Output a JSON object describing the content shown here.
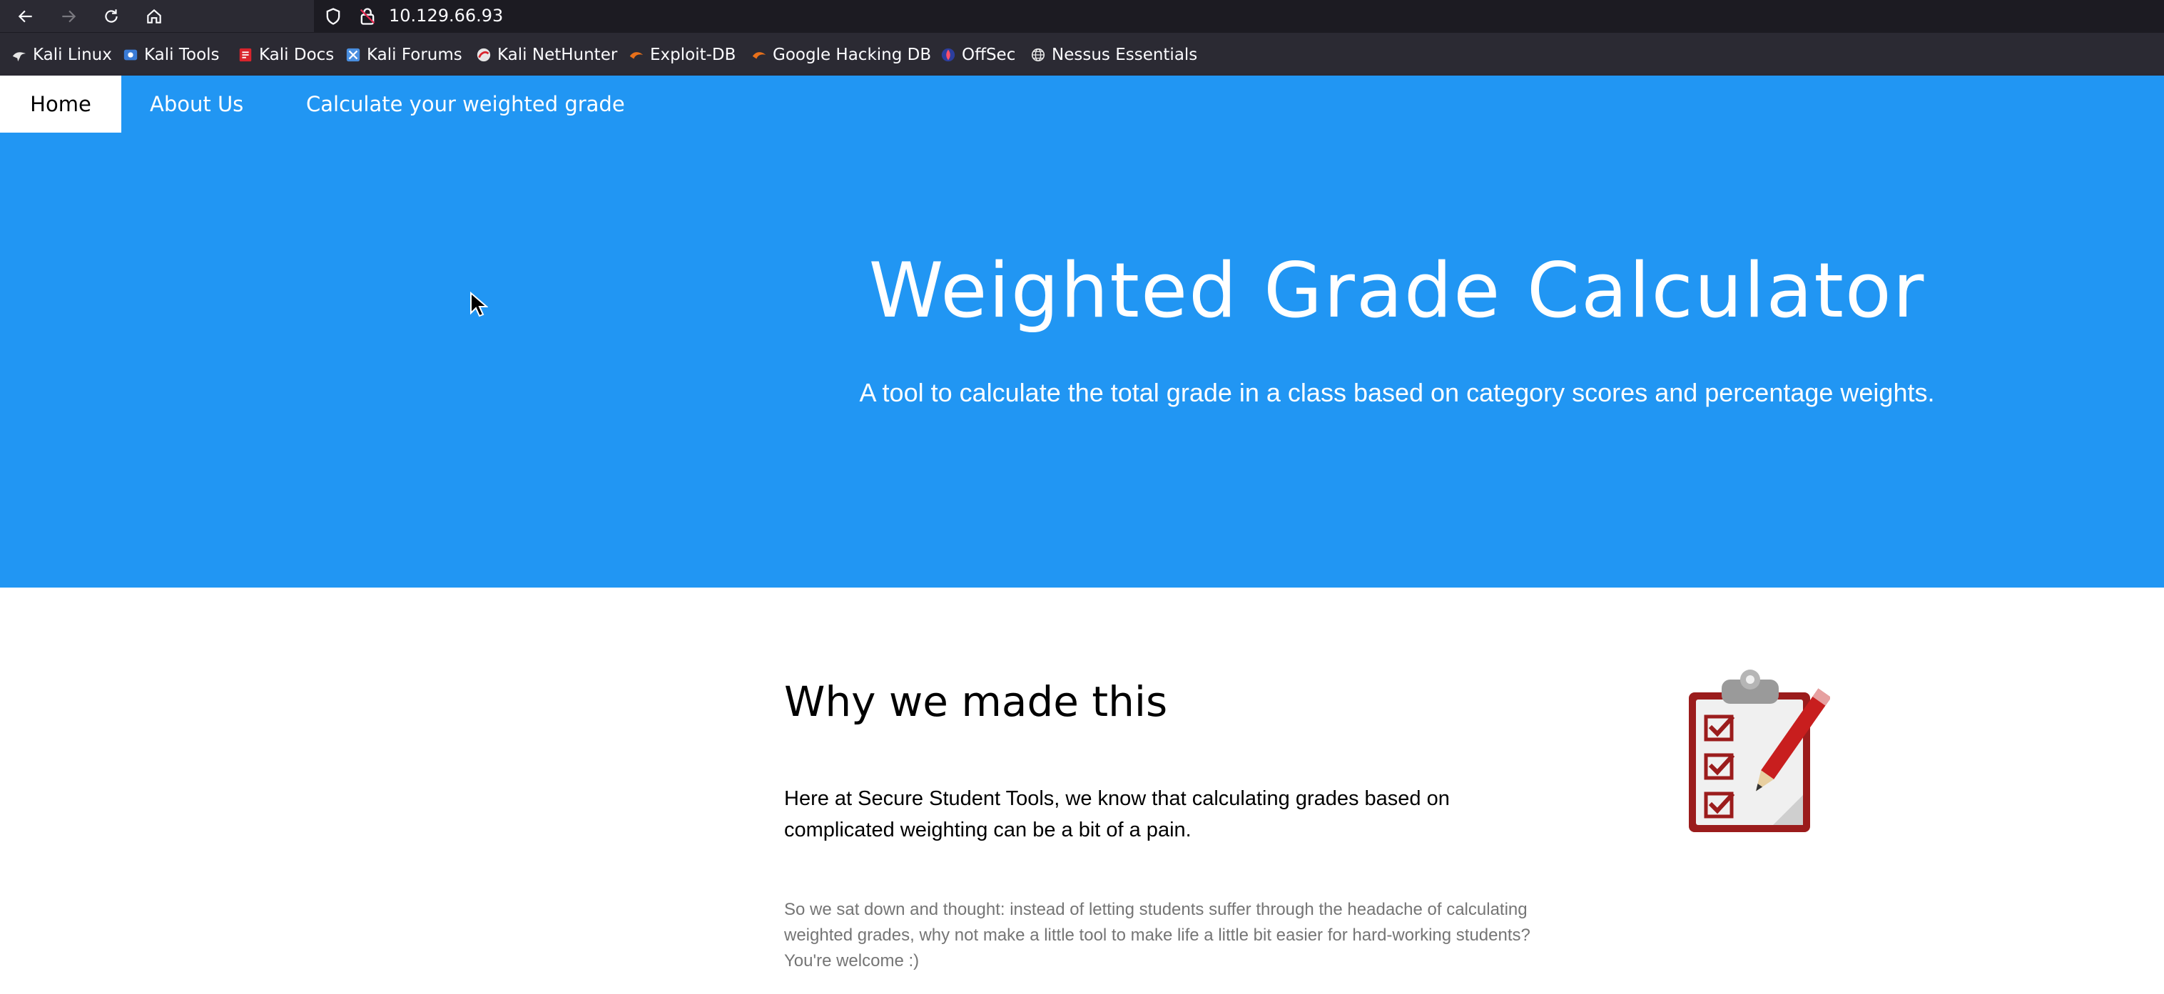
{
  "browser": {
    "url": "10.129.66.93",
    "nav_icons": [
      "back-arrow-icon",
      "forward-arrow-icon",
      "reload-icon",
      "home-icon"
    ],
    "url_icons": [
      "shield-icon",
      "lock-icon"
    ]
  },
  "bookmarks": [
    {
      "label": "Kali Linux",
      "icon": "kali-dragon-icon"
    },
    {
      "label": "Kali Tools",
      "icon": "kali-tools-icon"
    },
    {
      "label": "Kali Docs",
      "icon": "kali-docs-icon"
    },
    {
      "label": "Kali Forums",
      "icon": "kali-forums-icon"
    },
    {
      "label": "Kali NetHunter",
      "icon": "nethunter-icon"
    },
    {
      "label": "Exploit-DB",
      "icon": "exploit-db-icon"
    },
    {
      "label": "Google Hacking DB",
      "icon": "ghdb-icon"
    },
    {
      "label": "OffSec",
      "icon": "offsec-icon"
    },
    {
      "label": "Nessus Essentials",
      "icon": "globe-icon"
    }
  ],
  "site_nav": {
    "items": [
      {
        "label": "Home",
        "active": true
      },
      {
        "label": "About Us",
        "active": false
      },
      {
        "label": "Calculate your weighted grade",
        "active": false
      }
    ]
  },
  "hero": {
    "title": "Weighted Grade Calculator",
    "subtitle": "A tool to calculate the total grade in a class based on category scores and percentage weights."
  },
  "section": {
    "heading": "Why we made this",
    "lead": "Here at Secure Student Tools, we know that calculating grades based on complicated weighting can be a bit of a pain.",
    "body": "So we sat down and thought: instead of letting students suffer through the headache of calculating weighted grades, why not make a little tool to make life a little bit easier for hard-working students? You're welcome :)",
    "image_icon": "clipboard-checklist-pencil-icon"
  },
  "colors": {
    "brand_blue": "#2196f3",
    "browser_chrome": "#2b2a33",
    "urlbar_bg": "#1c1b22",
    "body_gray": "#757575"
  }
}
